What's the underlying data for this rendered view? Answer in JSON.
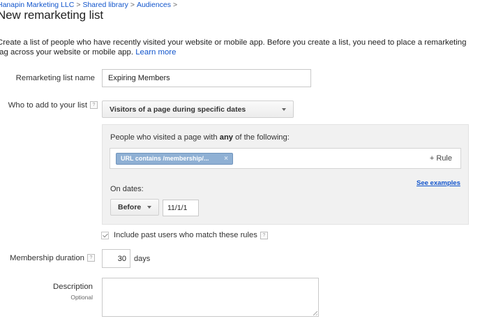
{
  "breadcrumb": {
    "items": [
      "Hanapin Marketing LLC",
      "Shared library",
      "Audiences"
    ],
    "separator": ">"
  },
  "page": {
    "title": "New remarketing list"
  },
  "intro": {
    "text": "Create a list of people who have recently visited your website or mobile app. Before you create a list, you need to place a remarketing tag across your website or mobile app.",
    "learn_more": "Learn more"
  },
  "form": {
    "name": {
      "label": "Remarketing list name",
      "value": "Expiring Members"
    },
    "who": {
      "label": "Who to add to your list",
      "help": "?",
      "selected": "Visitors of a page during specific dates"
    },
    "rules": {
      "heading_prefix": "People who visited a page with",
      "heading_emphasis": "any",
      "heading_suffix": "of the following:",
      "chip_label": "URL contains /membership/...",
      "chip_close": "×",
      "add_rule": "+ Rule",
      "see_examples": "See examples",
      "on_dates_label": "On dates:",
      "date_operator": "Before",
      "date_value": "11/1/1"
    },
    "include_past": {
      "label": "Include past users who match these rules",
      "checked": true,
      "help": "?"
    },
    "duration": {
      "label": "Membership duration",
      "help": "?",
      "value": "30",
      "unit": "days"
    },
    "description": {
      "label": "Description",
      "sublabel": "Optional",
      "value": ""
    }
  },
  "colors": {
    "link": "#1155cc",
    "chip_bg": "#8fb0d4",
    "panel_bg": "#f1f1f1"
  }
}
